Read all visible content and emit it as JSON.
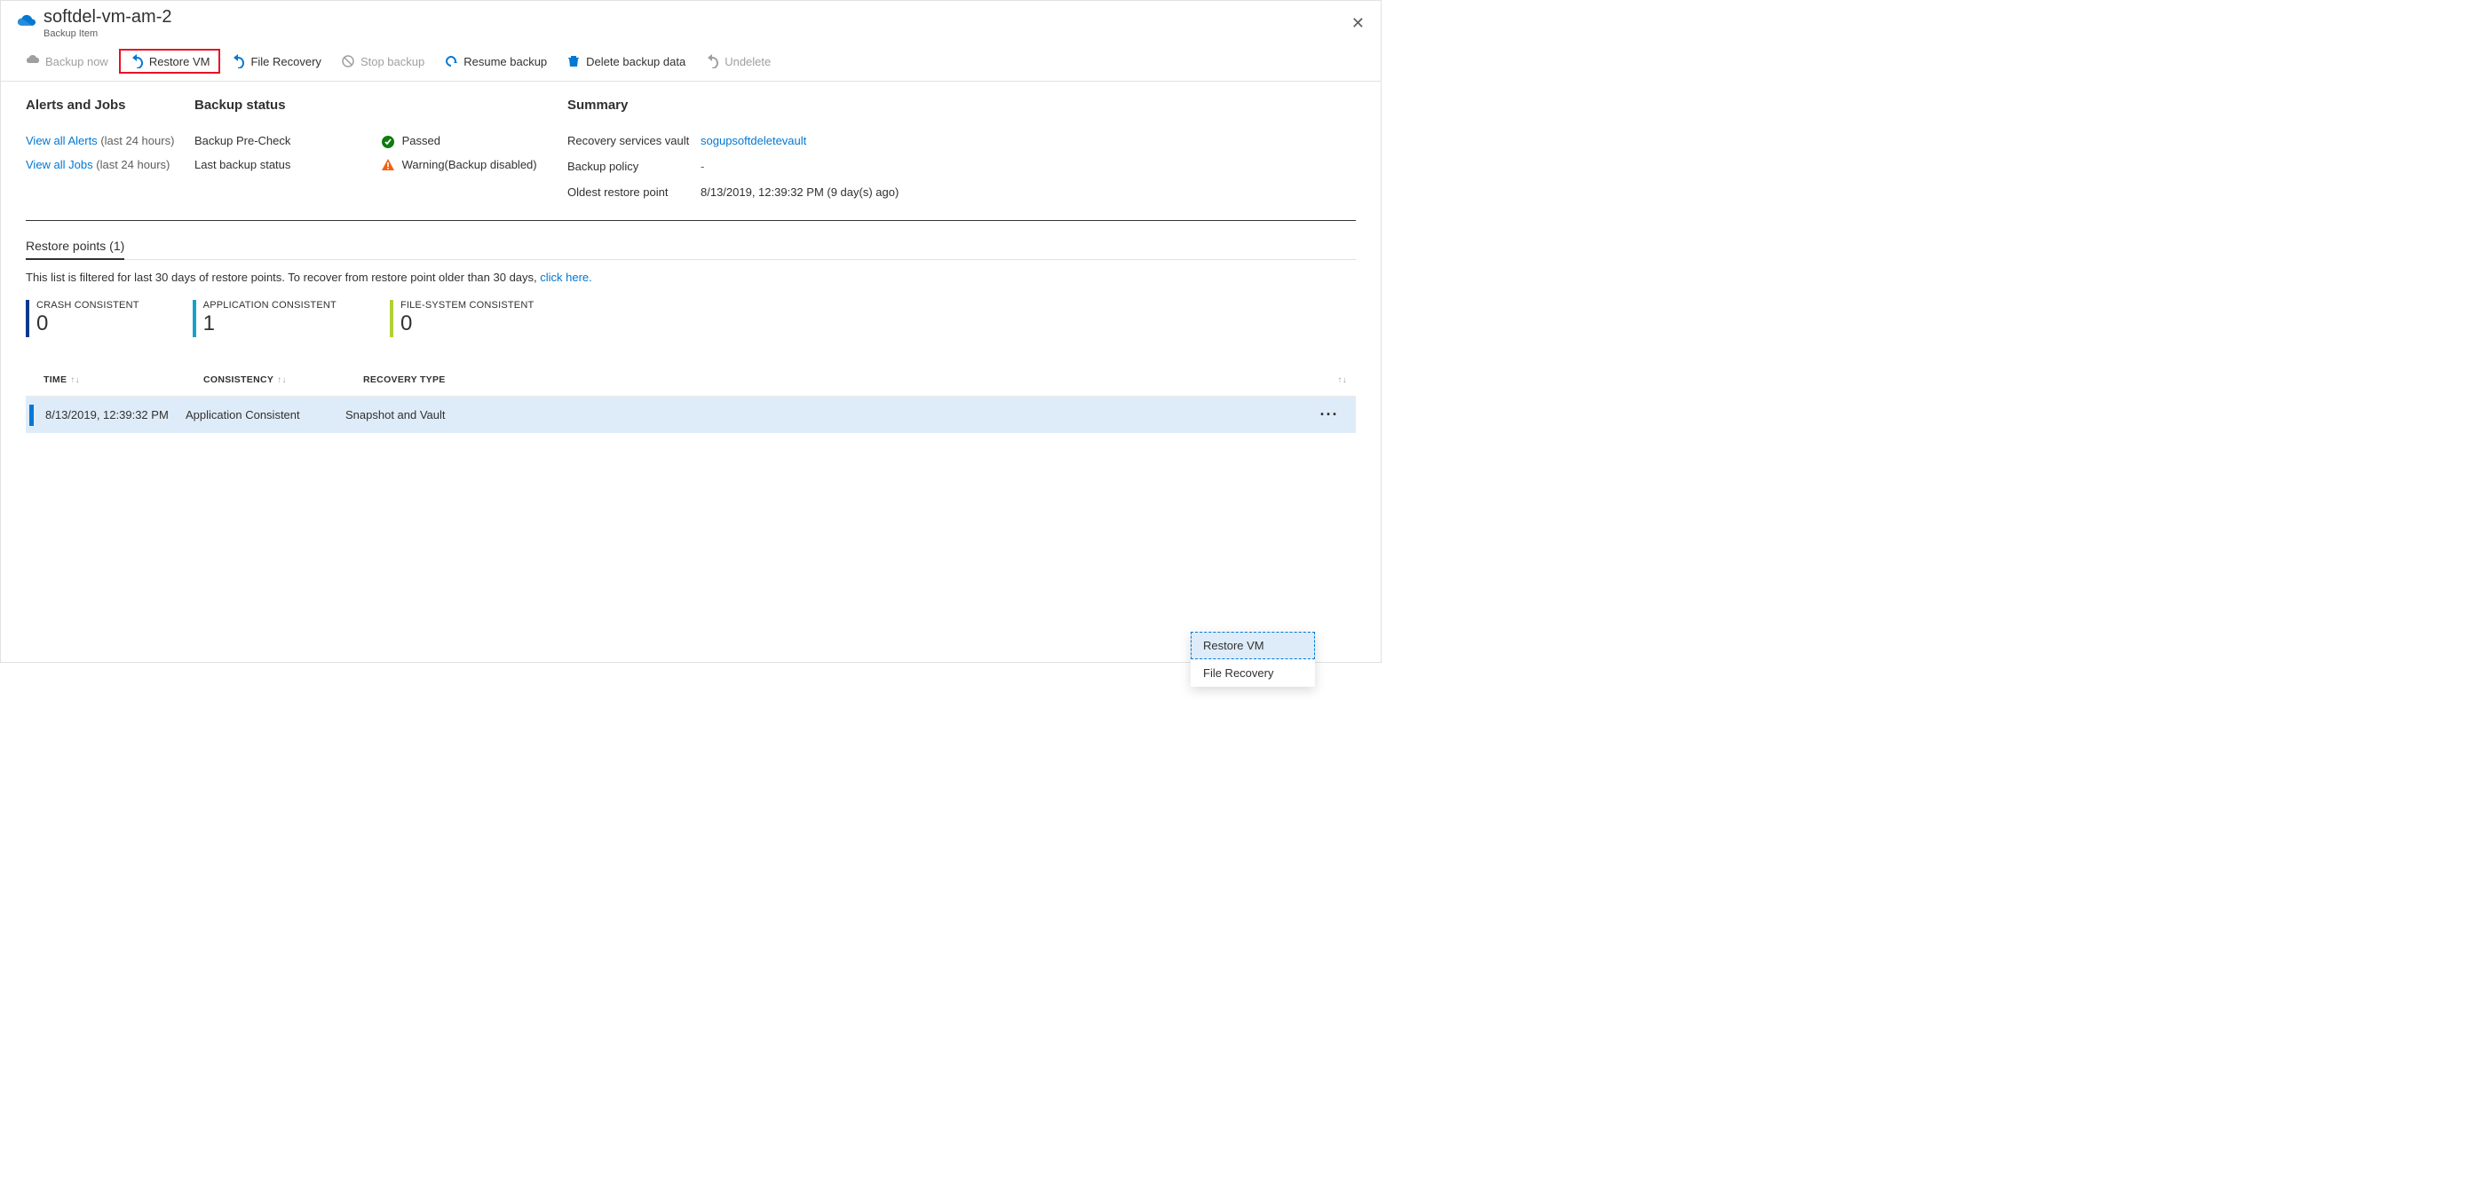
{
  "header": {
    "title": "softdel-vm-am-2",
    "subtitle": "Backup Item"
  },
  "toolbar": {
    "backup_now": "Backup now",
    "restore_vm": "Restore VM",
    "file_recovery": "File Recovery",
    "stop_backup": "Stop backup",
    "resume_backup": "Resume backup",
    "delete_backup_data": "Delete backup data",
    "undelete": "Undelete"
  },
  "sections": {
    "alerts_title": "Alerts and Jobs",
    "backup_status_title": "Backup status",
    "summary_title": "Summary"
  },
  "alerts": {
    "view_alerts": "View all Alerts",
    "view_alerts_meta": "(last 24 hours)",
    "view_jobs": "View all Jobs",
    "view_jobs_meta": "(last 24 hours)"
  },
  "backup_status": {
    "precheck_label": "Backup Pre-Check",
    "precheck_value": "Passed",
    "last_status_label": "Last backup status",
    "last_status_value": "Warning(Backup disabled)"
  },
  "summary": {
    "vault_label": "Recovery services vault",
    "vault_value": "sogupsoftdeletevault",
    "policy_label": "Backup policy",
    "policy_value": "-",
    "oldest_label": "Oldest restore point",
    "oldest_value": "8/13/2019, 12:39:32 PM (9 day(s) ago)"
  },
  "tab": {
    "label": "Restore points (1)"
  },
  "filter_note": {
    "text": "This list is filtered for last 30 days of restore points. To recover from restore point older than 30 days, ",
    "link": "click here."
  },
  "stats": {
    "crash": {
      "label": "CRASH CONSISTENT",
      "value": "0",
      "color": "#003a8c"
    },
    "app": {
      "label": "APPLICATION CONSISTENT",
      "value": "1",
      "color": "#15a1ce"
    },
    "fs": {
      "label": "FILE-SYSTEM CONSISTENT",
      "value": "0",
      "color": "#b0d136"
    }
  },
  "table": {
    "headers": {
      "time": "TIME",
      "consistency": "CONSISTENCY",
      "recovery_type": "RECOVERY TYPE"
    },
    "row": {
      "time": "8/13/2019, 12:39:32 PM",
      "consistency": "Application Consistent",
      "recovery_type": "Snapshot and Vault"
    }
  },
  "context_menu": {
    "restore_vm": "Restore VM",
    "file_recovery": "File Recovery"
  }
}
